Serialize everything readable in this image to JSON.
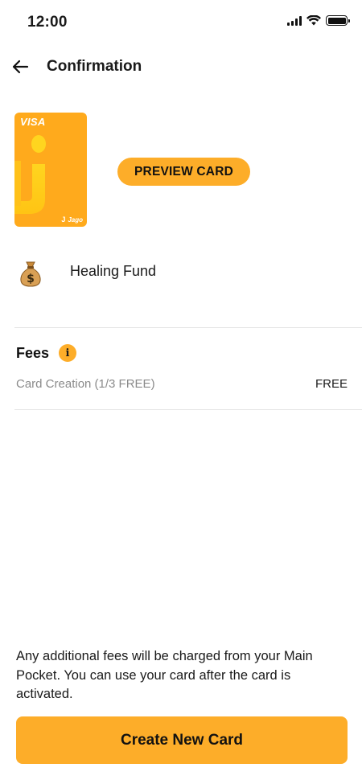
{
  "status_bar": {
    "time": "12:00"
  },
  "header": {
    "title": "Confirmation",
    "back_icon": "arrow-left-icon"
  },
  "card": {
    "network": "VISA",
    "brand": "Jago",
    "brand_mark": "J",
    "color": "#ffaa1c",
    "preview_label": "PREVIEW CARD"
  },
  "pocket": {
    "icon": "money-bag-icon",
    "name": "Healing Fund"
  },
  "fees": {
    "title": "Fees",
    "info_icon": "info-icon",
    "items": [
      {
        "label": "Card Creation (1/3 FREE)",
        "value": "FREE"
      }
    ]
  },
  "footer": {
    "notice": "Any additional fees will be charged from your Main Pocket. You can use your card after the card is activated.",
    "create_label": "Create New Card"
  },
  "colors": {
    "accent": "#fdad29",
    "text": "#1a1a1a",
    "muted": "#8a8a8a",
    "divider": "#e3e3e3"
  }
}
